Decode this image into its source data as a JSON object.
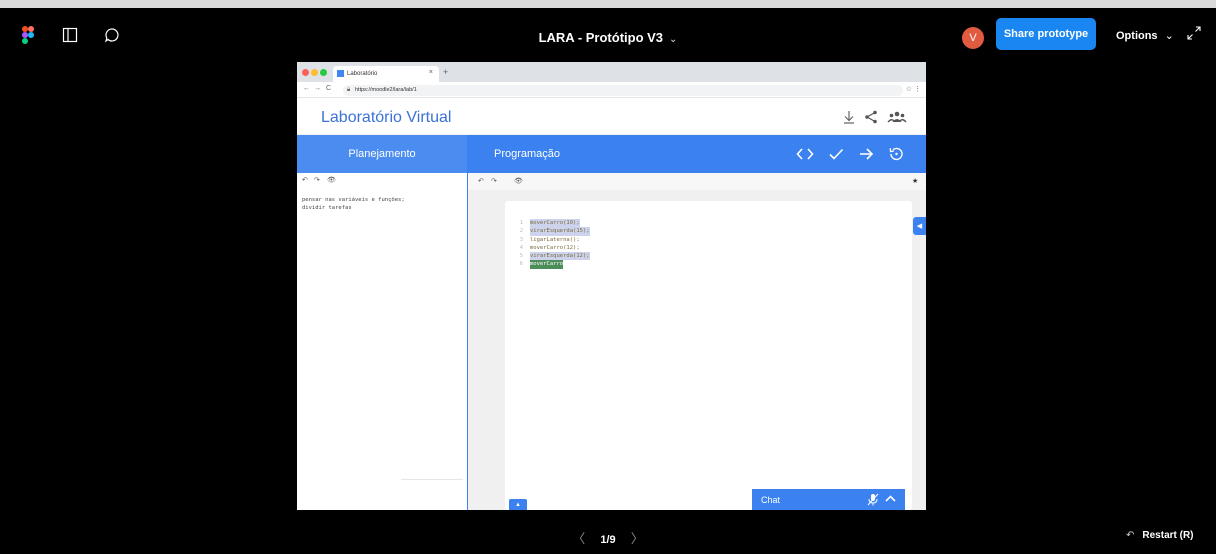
{
  "toolbar": {
    "title": "LARA - Protótipo V3",
    "title_chevron": "⌄",
    "avatar_initial": "V",
    "share_label": "Share prototype",
    "options_label": "Options",
    "options_chevron": "⌄"
  },
  "browser": {
    "tab_title": "Laboratório",
    "tab_close": "×",
    "new_tab": "+",
    "url": "https://moodle2/lara/lab/1"
  },
  "app": {
    "title": "Laboratório Virtual",
    "planning_label": "Planejamento",
    "programming_label": "Programação",
    "notes": "pensar nas variáveis e funções;\ndividir tarefas",
    "code_lines": [
      {
        "n": "1",
        "text": "moverCarro(10);",
        "hl": "sel"
      },
      {
        "n": "2",
        "text": "virarEsquerda(15);",
        "hl": "sel"
      },
      {
        "n": "3",
        "text": "ligarLaterna();",
        "hl": ""
      },
      {
        "n": "4",
        "text": "moverCarro(12);",
        "hl": ""
      },
      {
        "n": "5",
        "text": "virarEsquerda(12);",
        "hl": "sel"
      },
      {
        "n": "6",
        "text": "moverCarro",
        "hl": "sel2"
      }
    ],
    "chat_label": "Chat"
  },
  "footer": {
    "page_indicator": "1/9",
    "restart_label": "Restart (R)",
    "prev_arrow": "〈",
    "next_arrow": "〉"
  },
  "colors": {
    "accent": "#3b82f0",
    "share_button": "#1a86f2",
    "avatar": "#e05b3f"
  }
}
